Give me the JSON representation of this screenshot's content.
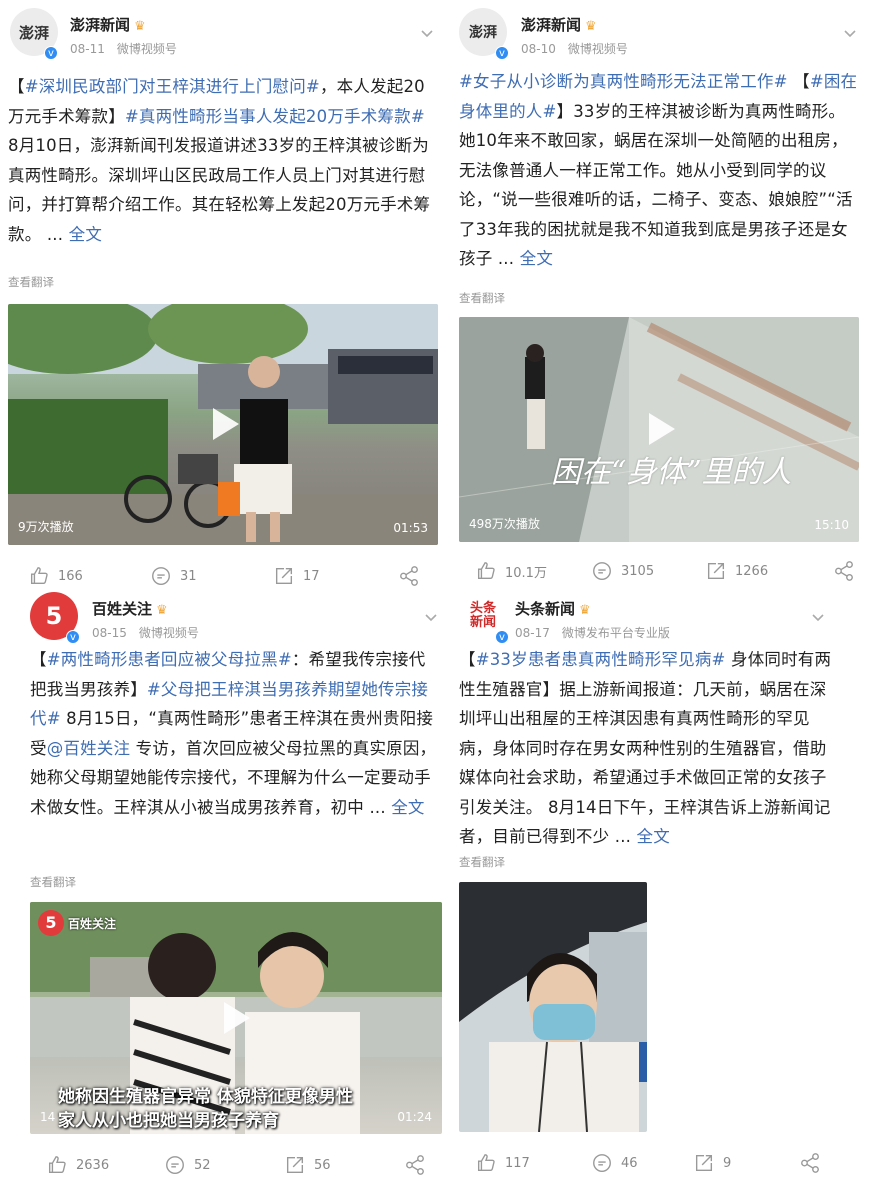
{
  "posts": [
    {
      "author": "澎湃新闻",
      "avatar_text": "澎湃",
      "date": "08-11",
      "source": "微博视频号",
      "text_parts": [
        {
          "t": "【",
          "k": "plain"
        },
        {
          "t": "#深圳民政部门对王梓淇进行上门慰问#",
          "k": "tag"
        },
        {
          "t": "，本人发起20万元手术筹款】",
          "k": "plain"
        },
        {
          "t": "#真两性畸形当事人发起20万手术筹款#",
          "k": "tag"
        },
        {
          "t": " 8月10日，澎湃新闻刊发报道讲述33岁的王梓淇被诊断为真两性畸形。深圳坪山区民政局工作人员上门对其进行慰问，并打算帮介绍工作。其在轻松筹上发起20万元手术筹款。 ...",
          "k": "plain"
        },
        {
          "t": " 全文",
          "k": "more"
        }
      ],
      "translate": "查看翻译",
      "video": {
        "views": "9万次播放",
        "duration": "01:53"
      },
      "likes": "166",
      "comments": "31",
      "reposts": "17"
    },
    {
      "author": "澎湃新闻",
      "avatar_text": "澎湃",
      "date": "08-10",
      "source": "微博视频号",
      "text_parts": [
        {
          "t": "#女子从小诊断为真两性畸形无法正常工作#",
          "k": "tag"
        },
        {
          "t": " 【",
          "k": "plain"
        },
        {
          "t": "#困在身体里的人#",
          "k": "tag"
        },
        {
          "t": "】33岁的王梓淇被诊断为真两性畸形。她10年来不敢回家，蜗居在深圳一处简陋的出租房，无法像普通人一样正常工作。她从小受到同学的议论，“说一些很难听的话，二椅子、变态、娘娘腔”“活了33年我的困扰就是我不知道我到底是男孩子还是女孩子 ...",
          "k": "plain"
        },
        {
          "t": " 全文",
          "k": "more"
        }
      ],
      "translate": "查看翻译",
      "video": {
        "views": "498万次播放",
        "duration": "15:10",
        "overlay": "困在“身体”里的人"
      },
      "likes": "10.1万",
      "comments": "3105",
      "reposts": "1266"
    },
    {
      "author": "百姓关注",
      "avatar_text": "5",
      "date": "08-15",
      "source": "微博视频号",
      "text_parts": [
        {
          "t": "【",
          "k": "plain"
        },
        {
          "t": "#两性畸形患者回应被父母拉黑#",
          "k": "tag"
        },
        {
          "t": "：希望我传宗接代 把我当男孩养】",
          "k": "plain"
        },
        {
          "t": "#父母把王梓淇当男孩养期望她传宗接代#",
          "k": "tag"
        },
        {
          "t": " 8月15日，“真两性畸形”患者王梓淇在贵州贵阳接受",
          "k": "plain"
        },
        {
          "t": "@百姓关注",
          "k": "mention"
        },
        {
          "t": " 专访，首次回应被父母拉黑的真实原因，她称父母期望她能传宗接代，不理解为什么一定要动手术做女性。王梓淇从小被当成男孩养育，初中 ...",
          "k": "plain"
        },
        {
          "t": " 全文",
          "k": "more"
        }
      ],
      "translate": "查看翻译",
      "video": {
        "views": "14",
        "duration": "01:24",
        "caption1": "她称因生殖器官异常 体貌特征更像男性",
        "caption2": "家人从小也把她当男孩子养育",
        "logo": "百姓关注"
      },
      "likes": "2636",
      "comments": "52",
      "reposts": "56"
    },
    {
      "author": "头条新闻",
      "avatar_text": "头条新闻",
      "date": "08-17",
      "source": "微博发布平台专业版",
      "text_parts": [
        {
          "t": "【",
          "k": "plain"
        },
        {
          "t": "#33岁患者患真两性畸形罕见病#",
          "k": "tag"
        },
        {
          "t": " 身体同时有两性生殖器官】据上游新闻报道：几天前，蜗居在深圳坪山出租屋的王梓淇因患有真两性畸形的罕见病，身体同时存在男女两种性别的生殖器官，借助媒体向社会求助，希望通过手术做回正常的女孩子引发关注。 8月14日下午，王梓淇告诉上游新闻记者，目前已得到不少 ...",
          "k": "plain"
        },
        {
          "t": " 全文",
          "k": "more"
        }
      ],
      "translate": "查看翻译",
      "likes": "117",
      "comments": "46",
      "reposts": "9"
    }
  ],
  "colors": {
    "link": "#3f6db3",
    "verified": "#2f8df3",
    "meta": "#999999"
  }
}
